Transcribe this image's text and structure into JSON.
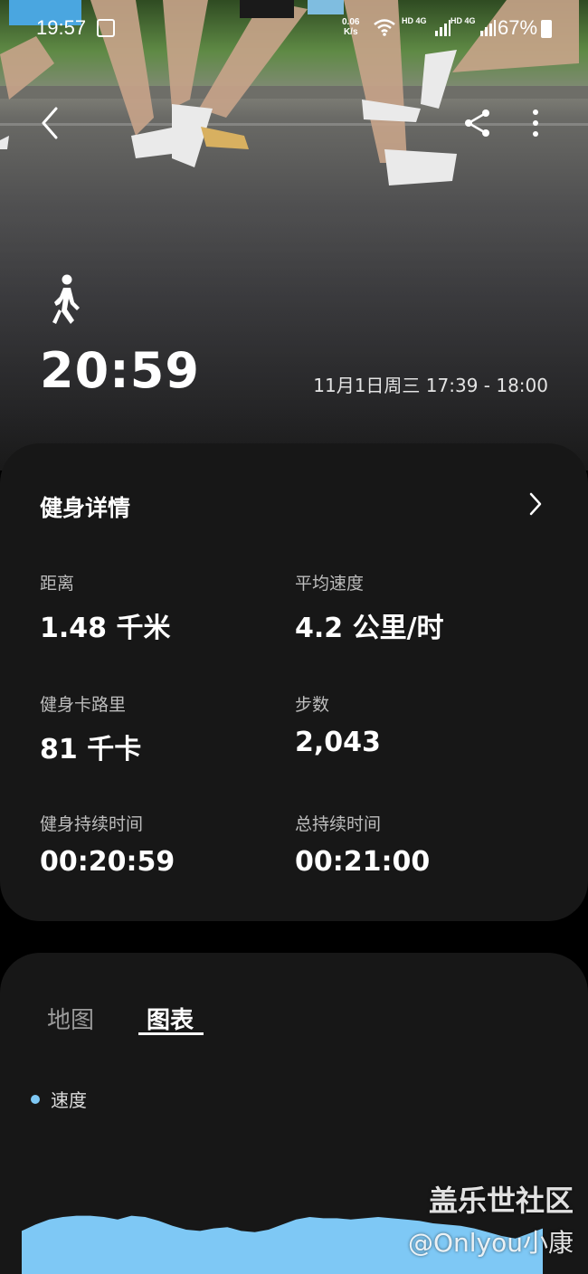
{
  "status_bar": {
    "time": "19:57",
    "net_speed_value": "0.06",
    "net_speed_unit": "K/s",
    "sim1": "HD 4G",
    "sim2": "HD 4G",
    "battery": "67%"
  },
  "header": {
    "duration": "20:59",
    "datetime": "11月1日周三 17:39 - 18:00",
    "activity_icon": "walk-icon"
  },
  "details": {
    "title": "健身详情",
    "metrics": [
      {
        "label": "距离",
        "value": "1.48 千米"
      },
      {
        "label": "平均速度",
        "value": "4.2 公里/时"
      },
      {
        "label": "健身卡路里",
        "value": "81 千卡"
      },
      {
        "label": "步数",
        "value": "2,043"
      },
      {
        "label": "健身持续时间",
        "value": "00:20:59"
      },
      {
        "label": "总持续时间",
        "value": "00:21:00"
      }
    ]
  },
  "chart": {
    "tabs": [
      "地图",
      "图表"
    ],
    "active_tab": "图表",
    "legend": "速度",
    "series_color": "#7ec8f5"
  },
  "chart_data": {
    "type": "area",
    "series": [
      {
        "name": "速度",
        "values": [
          3.4,
          3.9,
          4.3,
          4.5,
          4.6,
          4.6,
          4.5,
          4.3,
          4.6,
          4.5,
          4.2,
          3.8,
          3.5,
          3.4,
          3.6,
          3.7,
          3.4,
          3.3,
          3.5,
          3.9,
          4.3,
          4.5,
          4.4,
          4.4,
          4.3,
          4.4,
          4.5,
          4.4,
          4.3,
          4.2,
          4.0,
          3.9,
          3.8,
          3.6,
          3.3,
          3.0,
          2.8,
          3.2,
          3.6
        ]
      }
    ]
  },
  "watermark": {
    "line1": "盖乐世社区",
    "line2": "@Onlyou小康"
  }
}
